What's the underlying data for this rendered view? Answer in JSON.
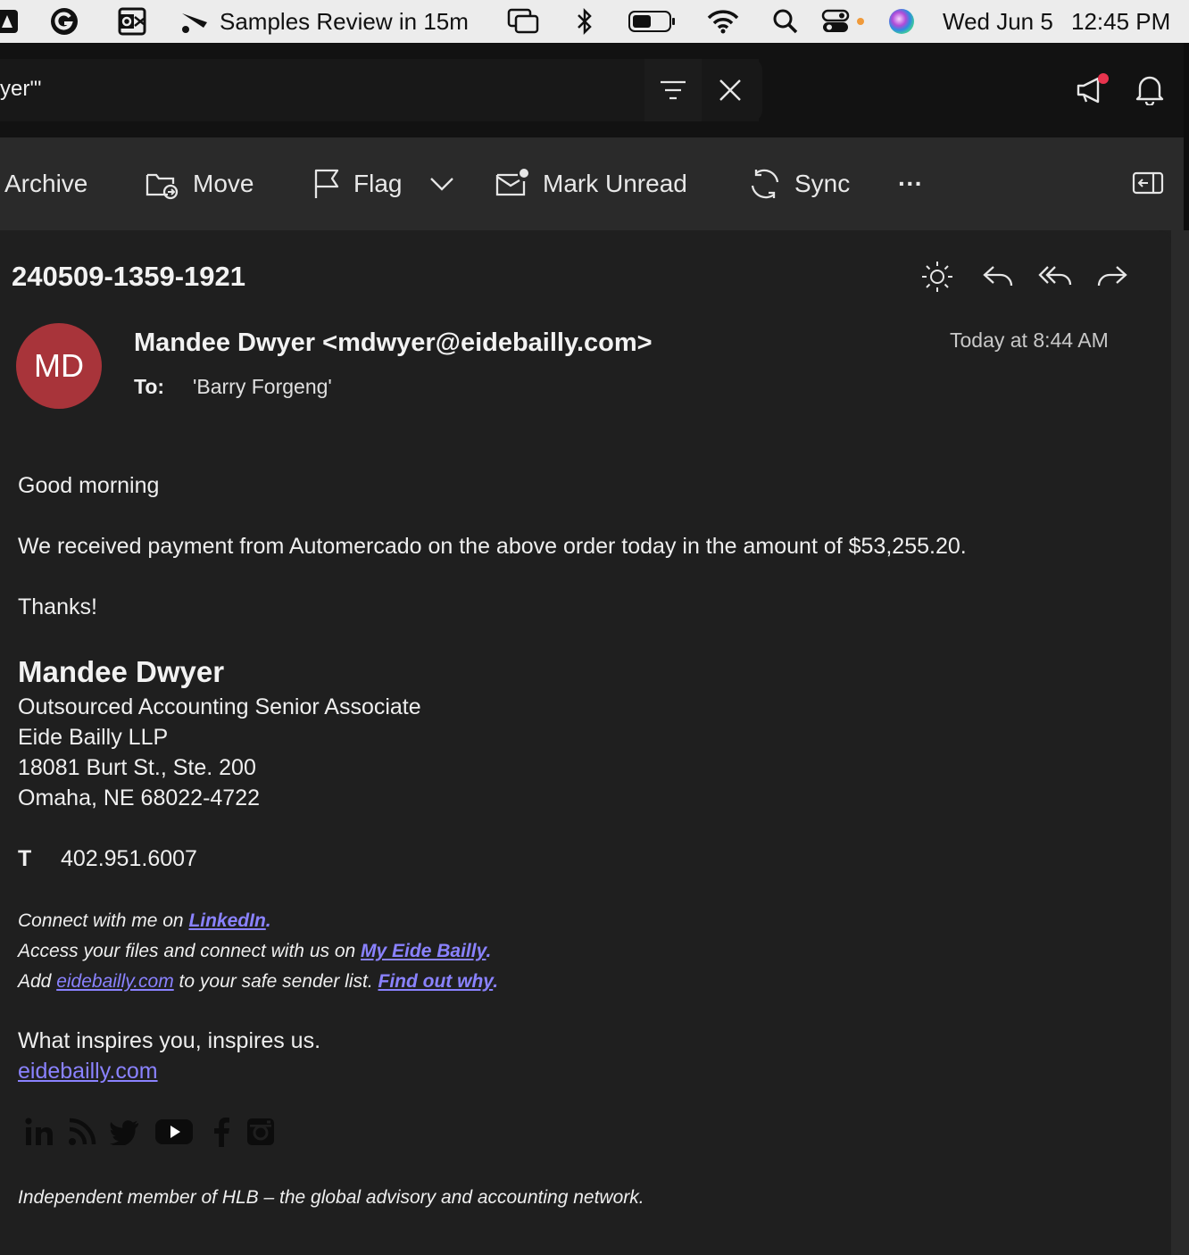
{
  "menubar": {
    "reminder": "Samples Review in 15m",
    "date": "Wed Jun 5",
    "time": "12:45 PM"
  },
  "search": {
    "query": "yer'\""
  },
  "toolbar": {
    "archive": "Archive",
    "move": "Move",
    "flag": "Flag",
    "mark_unread": "Mark Unread",
    "sync": "Sync",
    "more": "···"
  },
  "message": {
    "subject": "240509-1359-1921",
    "avatar_initials": "MD",
    "from": "Mandee Dwyer <mdwyer@eidebailly.com>",
    "to_label": "To:",
    "to": "'Barry Forgeng'",
    "date": "Today at 8:44 AM",
    "greeting": "Good morning",
    "body": "We received payment from Automercado on the above order today in the amount of $53,255.20.",
    "closing": "Thanks!"
  },
  "signature": {
    "name": "Mandee Dwyer",
    "title": "Outsourced Accounting Senior Associate",
    "company": "Eide Bailly LLP",
    "address1": "18081 Burt St., Ste. 200",
    "address2": "Omaha, NE 68022-4722",
    "phone_label": "T",
    "phone": "402.951.6007",
    "connect_prefix": "Connect with me on ",
    "connect_link": "LinkedIn",
    "access_prefix": "Access your files and connect with us on ",
    "access_link": "My Eide Bailly",
    "add_prefix": "Add ",
    "add_link": "eidebailly.com",
    "add_middle": " to your safe sender list. ",
    "add_link2": "Find out why",
    "period": ".",
    "tagline": "What inspires you, inspires us.",
    "website": "eidebailly.com",
    "footer": "Independent member of HLB – the global advisory and accounting network."
  },
  "colors": {
    "avatar": "#a8343a",
    "link": "#8a82ff",
    "badge": "#e8344e"
  }
}
